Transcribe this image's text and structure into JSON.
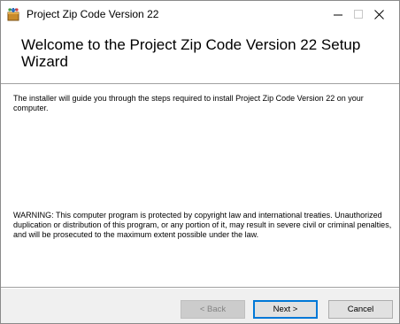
{
  "window": {
    "title": "Project Zip Code Version 22"
  },
  "title_buttons": {
    "minimize": "—",
    "maximize": "☐",
    "close": "✕"
  },
  "header": {
    "title": "Welcome to the Project Zip Code Version 22 Setup Wizard"
  },
  "content": {
    "intro": "The installer will guide you through the steps required to install Project Zip Code Version 22 on your computer.",
    "warning": "WARNING: This computer program is protected by copyright law and international treaties. Unauthorized duplication or distribution of this program, or any portion of it, may result in severe civil or criminal penalties, and will be prosecuted to the maximum extent possible under the law."
  },
  "buttons": {
    "back": "< Back",
    "next": "Next >",
    "cancel": "Cancel"
  },
  "colors": {
    "accent": "#0078d7",
    "dialog_bg": "#f0f0f0",
    "panel_bg": "#ffffff"
  },
  "icons": {
    "app": "installer-package-icon"
  }
}
